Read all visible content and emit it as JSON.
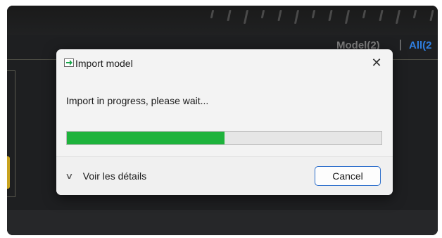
{
  "background": {
    "tabs": {
      "model": "Model(2)",
      "separator": "|",
      "all": "All(2"
    }
  },
  "dialog": {
    "title": "Import model",
    "close_glyph": "✕",
    "message": "Import in progress, please wait...",
    "progress_percent": 50,
    "details_chevron": "∨",
    "details_label": "Voir les détails",
    "cancel_label": "Cancel"
  },
  "colors": {
    "progress_fill": "#1eb33c",
    "accent": "#2c6ecb",
    "tab_active": "#2f7fe0"
  },
  "icons": {
    "app": "import-arrow-icon",
    "close": "close-icon",
    "details": "chevron-down-icon"
  }
}
